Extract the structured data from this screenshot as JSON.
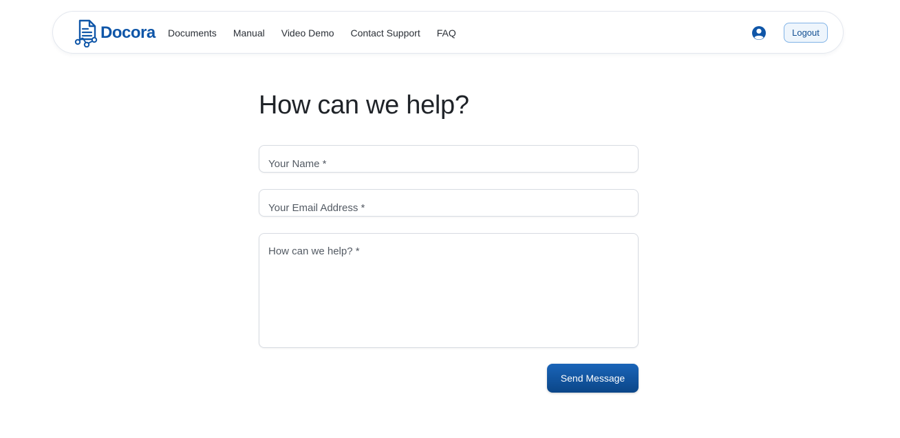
{
  "brand": {
    "name": "Docora",
    "color": "#0f56a8"
  },
  "nav": {
    "links": [
      "Documents",
      "Manual",
      "Video Demo",
      "Contact Support",
      "FAQ"
    ]
  },
  "header": {
    "user_icon": "user-circle-icon",
    "logout_label": "Logout"
  },
  "main": {
    "title": "How can we help?",
    "form": {
      "name_placeholder": "Your Name *",
      "email_placeholder": "Your Email Address *",
      "message_placeholder": "How can we help? *",
      "submit_label": "Send Message"
    }
  },
  "colors": {
    "accent": "#0f56a8",
    "button": "#0b4688"
  }
}
